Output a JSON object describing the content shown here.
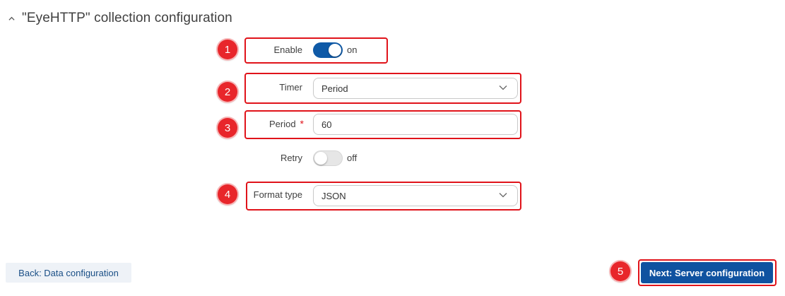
{
  "section": {
    "title": "\"EyeHTTP\" collection configuration"
  },
  "badges": [
    "1",
    "2",
    "3",
    "4",
    "5"
  ],
  "enable": {
    "label": "Enable",
    "state": "on"
  },
  "timer": {
    "label": "Timer",
    "value": "Period"
  },
  "period": {
    "label": "Period",
    "required_mark": "*",
    "value": "60"
  },
  "retry": {
    "label": "Retry",
    "state": "off"
  },
  "format_type": {
    "label": "Format type",
    "value": "JSON"
  },
  "buttons": {
    "back": "Back: Data configuration",
    "next": "Next: Server configuration"
  },
  "colors": {
    "highlight": "#e0131a",
    "accent": "#0f5aa7",
    "badge": "#e8262b"
  },
  "icons": {
    "section": "chevron-up-icon",
    "select": "chevron-down-icon"
  }
}
